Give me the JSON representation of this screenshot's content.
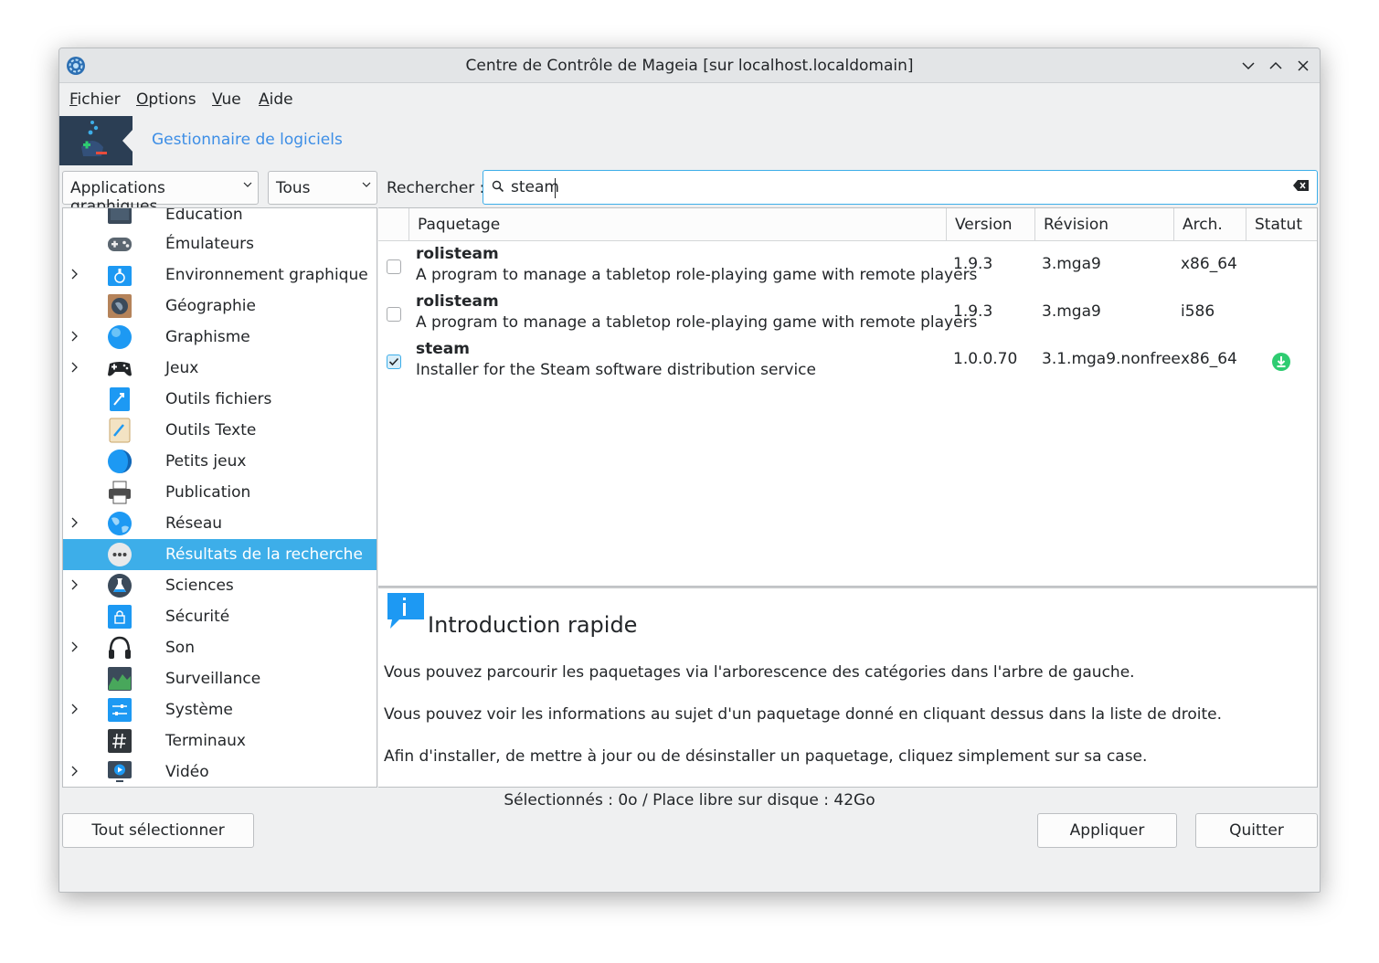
{
  "window": {
    "title": "Centre de Contrôle de Mageia [sur localhost.localdomain]"
  },
  "menu": [
    {
      "accel": "F",
      "rest": "ichier"
    },
    {
      "accel": "O",
      "rest": "ptions"
    },
    {
      "accel": "V",
      "rest": "ue"
    },
    {
      "accel": "A",
      "rest": "ide"
    }
  ],
  "banner": {
    "title": "Gestionnaire de logiciels"
  },
  "filters": {
    "type": "Applications graphiques",
    "state": "Tous"
  },
  "search": {
    "label": "Rechercher :",
    "value": "steam"
  },
  "categories": [
    {
      "label": "Éducation",
      "expandable": false,
      "icon": "education-icon"
    },
    {
      "label": "Émulateurs",
      "expandable": false,
      "icon": "gamepad-icon"
    },
    {
      "label": "Environnement graphique",
      "expandable": true,
      "icon": "desktop-icon"
    },
    {
      "label": "Géographie",
      "expandable": false,
      "icon": "globe-map-icon"
    },
    {
      "label": "Graphisme",
      "expandable": true,
      "icon": "graphics-sphere-icon"
    },
    {
      "label": "Jeux",
      "expandable": true,
      "icon": "joystick-icon"
    },
    {
      "label": "Outils fichiers",
      "expandable": false,
      "icon": "file-tools-icon"
    },
    {
      "label": "Outils Texte",
      "expandable": false,
      "icon": "text-tools-icon"
    },
    {
      "label": "Petits jeux",
      "expandable": false,
      "icon": "small-games-icon"
    },
    {
      "label": "Publication",
      "expandable": false,
      "icon": "printer-icon"
    },
    {
      "label": "Réseau",
      "expandable": true,
      "icon": "network-globe-icon"
    },
    {
      "label": "Résultats de la recherche",
      "expandable": false,
      "icon": "more-dots-icon",
      "selected": true
    },
    {
      "label": "Sciences",
      "expandable": true,
      "icon": "flask-icon"
    },
    {
      "label": "Sécurité",
      "expandable": false,
      "icon": "lock-icon"
    },
    {
      "label": "Son",
      "expandable": true,
      "icon": "headphones-icon"
    },
    {
      "label": "Surveillance",
      "expandable": false,
      "icon": "monitor-graph-icon"
    },
    {
      "label": "Système",
      "expandable": true,
      "icon": "system-settings-icon"
    },
    {
      "label": "Terminaux",
      "expandable": false,
      "icon": "terminal-icon"
    },
    {
      "label": "Vidéo",
      "expandable": true,
      "icon": "video-icon"
    }
  ],
  "table": {
    "headers": [
      "Paquetage",
      "Version",
      "Révision",
      "Arch.",
      "Statut"
    ],
    "rows": [
      {
        "name": "rolisteam",
        "desc": "A program to manage a tabletop role-playing game with remote players",
        "version": "1.9.3",
        "revision": "3.mga9",
        "arch": "x86_64",
        "checked": false,
        "status": ""
      },
      {
        "name": "rolisteam",
        "desc": "A program to manage a tabletop role-playing game with remote players",
        "version": "1.9.3",
        "revision": "3.mga9",
        "arch": "i586",
        "checked": false,
        "status": ""
      },
      {
        "name": "steam",
        "desc": "Installer for the Steam software distribution service",
        "version": "1.0.0.70",
        "revision": "3.1.mga9.nonfree",
        "arch": "x86_64",
        "checked": true,
        "status": "install-icon"
      }
    ]
  },
  "info": {
    "title": "Introduction rapide",
    "paragraphs": [
      "Vous pouvez parcourir les paquetages via l'arborescence des catégories dans l'arbre de gauche.",
      "Vous pouvez voir les informations au sujet d'un paquetage donné en cliquant dessus dans la liste de droite.",
      "Afin d'installer, de mettre à jour ou de désinstaller un paquetage, cliquez simplement sur sa case."
    ]
  },
  "status": "Sélectionnés : 0o / Place libre sur disque : 42Go",
  "buttons": {
    "select_all": "Tout sélectionner",
    "apply": "Appliquer",
    "quit": "Quitter"
  },
  "colors": {
    "accent": "#3daee9",
    "banner_link": "#3d8ee6",
    "install": "#2ecc71"
  }
}
